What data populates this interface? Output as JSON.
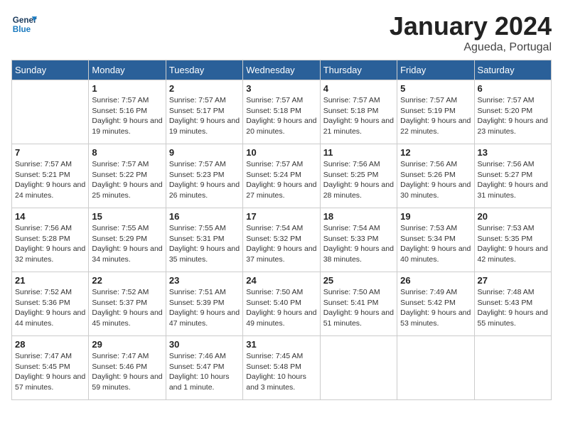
{
  "header": {
    "logo_line1": "General",
    "logo_line2": "Blue",
    "month": "January 2024",
    "location": "Agueda, Portugal"
  },
  "columns": [
    "Sunday",
    "Monday",
    "Tuesday",
    "Wednesday",
    "Thursday",
    "Friday",
    "Saturday"
  ],
  "weeks": [
    [
      {
        "day": "",
        "sunrise": "",
        "sunset": "",
        "daylight": ""
      },
      {
        "day": "1",
        "sunrise": "Sunrise: 7:57 AM",
        "sunset": "Sunset: 5:16 PM",
        "daylight": "Daylight: 9 hours and 19 minutes."
      },
      {
        "day": "2",
        "sunrise": "Sunrise: 7:57 AM",
        "sunset": "Sunset: 5:17 PM",
        "daylight": "Daylight: 9 hours and 19 minutes."
      },
      {
        "day": "3",
        "sunrise": "Sunrise: 7:57 AM",
        "sunset": "Sunset: 5:18 PM",
        "daylight": "Daylight: 9 hours and 20 minutes."
      },
      {
        "day": "4",
        "sunrise": "Sunrise: 7:57 AM",
        "sunset": "Sunset: 5:18 PM",
        "daylight": "Daylight: 9 hours and 21 minutes."
      },
      {
        "day": "5",
        "sunrise": "Sunrise: 7:57 AM",
        "sunset": "Sunset: 5:19 PM",
        "daylight": "Daylight: 9 hours and 22 minutes."
      },
      {
        "day": "6",
        "sunrise": "Sunrise: 7:57 AM",
        "sunset": "Sunset: 5:20 PM",
        "daylight": "Daylight: 9 hours and 23 minutes."
      }
    ],
    [
      {
        "day": "7",
        "sunrise": "Sunrise: 7:57 AM",
        "sunset": "Sunset: 5:21 PM",
        "daylight": "Daylight: 9 hours and 24 minutes."
      },
      {
        "day": "8",
        "sunrise": "Sunrise: 7:57 AM",
        "sunset": "Sunset: 5:22 PM",
        "daylight": "Daylight: 9 hours and 25 minutes."
      },
      {
        "day": "9",
        "sunrise": "Sunrise: 7:57 AM",
        "sunset": "Sunset: 5:23 PM",
        "daylight": "Daylight: 9 hours and 26 minutes."
      },
      {
        "day": "10",
        "sunrise": "Sunrise: 7:57 AM",
        "sunset": "Sunset: 5:24 PM",
        "daylight": "Daylight: 9 hours and 27 minutes."
      },
      {
        "day": "11",
        "sunrise": "Sunrise: 7:56 AM",
        "sunset": "Sunset: 5:25 PM",
        "daylight": "Daylight: 9 hours and 28 minutes."
      },
      {
        "day": "12",
        "sunrise": "Sunrise: 7:56 AM",
        "sunset": "Sunset: 5:26 PM",
        "daylight": "Daylight: 9 hours and 30 minutes."
      },
      {
        "day": "13",
        "sunrise": "Sunrise: 7:56 AM",
        "sunset": "Sunset: 5:27 PM",
        "daylight": "Daylight: 9 hours and 31 minutes."
      }
    ],
    [
      {
        "day": "14",
        "sunrise": "Sunrise: 7:56 AM",
        "sunset": "Sunset: 5:28 PM",
        "daylight": "Daylight: 9 hours and 32 minutes."
      },
      {
        "day": "15",
        "sunrise": "Sunrise: 7:55 AM",
        "sunset": "Sunset: 5:29 PM",
        "daylight": "Daylight: 9 hours and 34 minutes."
      },
      {
        "day": "16",
        "sunrise": "Sunrise: 7:55 AM",
        "sunset": "Sunset: 5:31 PM",
        "daylight": "Daylight: 9 hours and 35 minutes."
      },
      {
        "day": "17",
        "sunrise": "Sunrise: 7:54 AM",
        "sunset": "Sunset: 5:32 PM",
        "daylight": "Daylight: 9 hours and 37 minutes."
      },
      {
        "day": "18",
        "sunrise": "Sunrise: 7:54 AM",
        "sunset": "Sunset: 5:33 PM",
        "daylight": "Daylight: 9 hours and 38 minutes."
      },
      {
        "day": "19",
        "sunrise": "Sunrise: 7:53 AM",
        "sunset": "Sunset: 5:34 PM",
        "daylight": "Daylight: 9 hours and 40 minutes."
      },
      {
        "day": "20",
        "sunrise": "Sunrise: 7:53 AM",
        "sunset": "Sunset: 5:35 PM",
        "daylight": "Daylight: 9 hours and 42 minutes."
      }
    ],
    [
      {
        "day": "21",
        "sunrise": "Sunrise: 7:52 AM",
        "sunset": "Sunset: 5:36 PM",
        "daylight": "Daylight: 9 hours and 44 minutes."
      },
      {
        "day": "22",
        "sunrise": "Sunrise: 7:52 AM",
        "sunset": "Sunset: 5:37 PM",
        "daylight": "Daylight: 9 hours and 45 minutes."
      },
      {
        "day": "23",
        "sunrise": "Sunrise: 7:51 AM",
        "sunset": "Sunset: 5:39 PM",
        "daylight": "Daylight: 9 hours and 47 minutes."
      },
      {
        "day": "24",
        "sunrise": "Sunrise: 7:50 AM",
        "sunset": "Sunset: 5:40 PM",
        "daylight": "Daylight: 9 hours and 49 minutes."
      },
      {
        "day": "25",
        "sunrise": "Sunrise: 7:50 AM",
        "sunset": "Sunset: 5:41 PM",
        "daylight": "Daylight: 9 hours and 51 minutes."
      },
      {
        "day": "26",
        "sunrise": "Sunrise: 7:49 AM",
        "sunset": "Sunset: 5:42 PM",
        "daylight": "Daylight: 9 hours and 53 minutes."
      },
      {
        "day": "27",
        "sunrise": "Sunrise: 7:48 AM",
        "sunset": "Sunset: 5:43 PM",
        "daylight": "Daylight: 9 hours and 55 minutes."
      }
    ],
    [
      {
        "day": "28",
        "sunrise": "Sunrise: 7:47 AM",
        "sunset": "Sunset: 5:45 PM",
        "daylight": "Daylight: 9 hours and 57 minutes."
      },
      {
        "day": "29",
        "sunrise": "Sunrise: 7:47 AM",
        "sunset": "Sunset: 5:46 PM",
        "daylight": "Daylight: 9 hours and 59 minutes."
      },
      {
        "day": "30",
        "sunrise": "Sunrise: 7:46 AM",
        "sunset": "Sunset: 5:47 PM",
        "daylight": "Daylight: 10 hours and 1 minute."
      },
      {
        "day": "31",
        "sunrise": "Sunrise: 7:45 AM",
        "sunset": "Sunset: 5:48 PM",
        "daylight": "Daylight: 10 hours and 3 minutes."
      },
      {
        "day": "",
        "sunrise": "",
        "sunset": "",
        "daylight": ""
      },
      {
        "day": "",
        "sunrise": "",
        "sunset": "",
        "daylight": ""
      },
      {
        "day": "",
        "sunrise": "",
        "sunset": "",
        "daylight": ""
      }
    ]
  ]
}
